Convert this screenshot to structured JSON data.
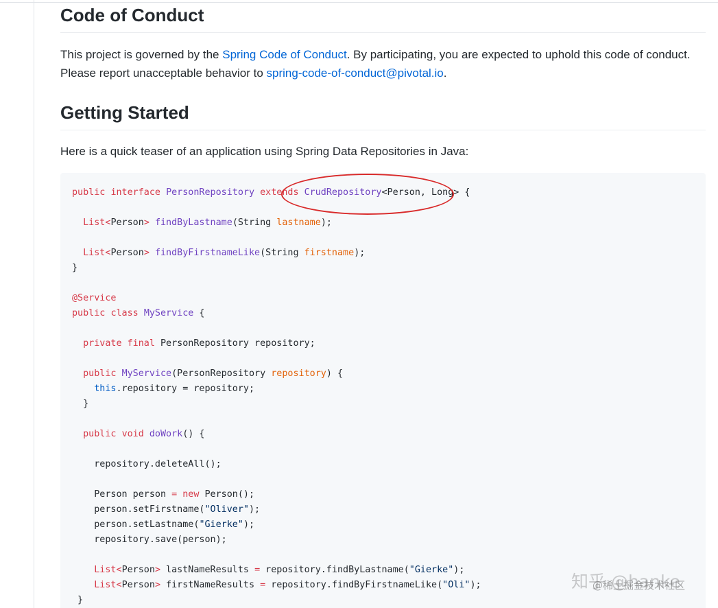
{
  "sections": {
    "conduct": {
      "heading": "Code of Conduct",
      "text_before_link": "This project is governed by the ",
      "link_text": "Spring Code of Conduct",
      "text_mid": ". By participating, you are expected to uphold this code of conduct. Please report unacceptable behavior to ",
      "email_link": "spring-code-of-conduct@pivotal.io",
      "text_after": "."
    },
    "getting_started": {
      "heading": "Getting Started",
      "intro": "Here is a quick teaser of an application using Spring Data Repositories in Java:"
    }
  },
  "code": {
    "language": "Java",
    "lines": [
      "public interface PersonRepository extends CrudRepository<Person, Long> {",
      "",
      "  List<Person> findByLastname(String lastname);",
      "",
      "  List<Person> findByFirstnameLike(String firstname);",
      "}",
      "",
      "@Service",
      "public class MyService {",
      "",
      "  private final PersonRepository repository;",
      "",
      "  public MyService(PersonRepository repository) {",
      "    this.repository = repository;",
      "  }",
      "",
      "  public void doWork() {",
      "",
      "    repository.deleteAll();",
      "",
      "    Person person = new Person();",
      "    person.setFirstname(\"Oliver\");",
      "    person.setLastname(\"Gierke\");",
      "    repository.save(person);",
      "",
      "    List<Person> lastNameResults = repository.findByLastname(\"Gierke\");",
      "    List<Person> firstNameResults = repository.findByFirstnameLike(\"Oli\");",
      " }"
    ]
  },
  "annotation": {
    "type": "red-ellipse-highlight",
    "color": "#d92b2b"
  },
  "watermark": {
    "main": "知乎 @hanke",
    "sub": "@稀土掘金技术社区"
  },
  "colors": {
    "link": "#0366d6",
    "keyword": "#d73a49",
    "type": "#6f42c1",
    "param": "#e36209",
    "constant": "#005cc5",
    "string": "#032f62",
    "code_bg": "#f6f8fa"
  }
}
